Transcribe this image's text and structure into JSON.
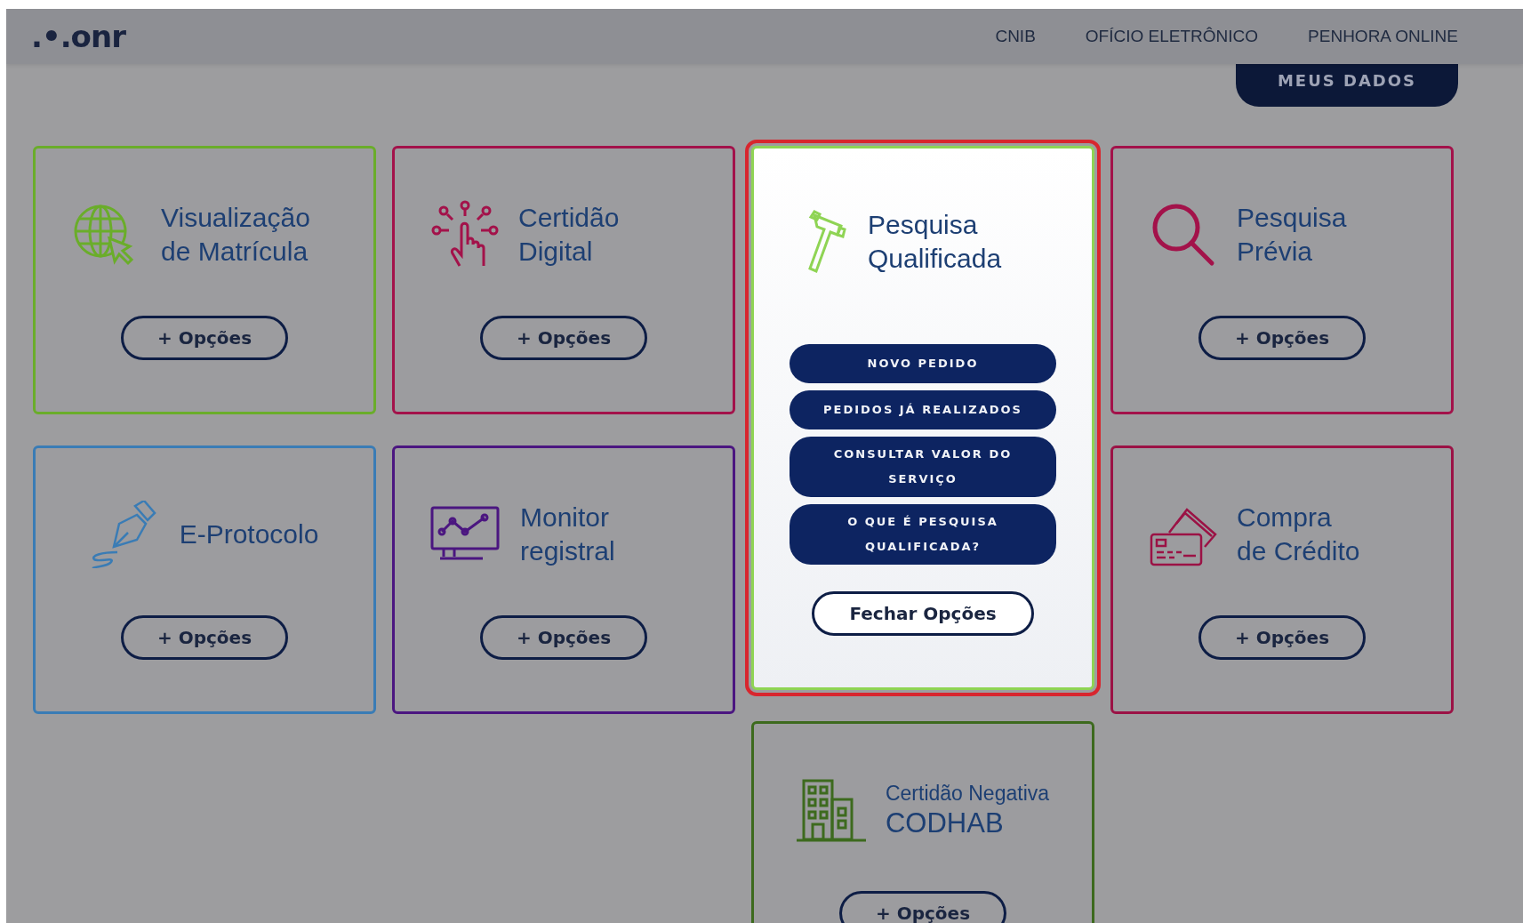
{
  "header": {
    "logo": ".•.onr",
    "nav": [
      "CNIB",
      "OFÍCIO ELETRÔNICO",
      "PENHORA ONLINE"
    ]
  },
  "account_button": "MEUS DADOS",
  "card_columns": [
    [
      {
        "title": "Visualização de Matrícula",
        "color": "#6aad2a",
        "expanded": false,
        "button": "+ Opções"
      },
      {
        "title": "E-Protocolo",
        "color": "#3a7cb5",
        "expanded": false,
        "button": "+ Opções"
      }
    ],
    [
      {
        "title": "Certidão Digital",
        "color": "#a3124a",
        "expanded": false,
        "button": "+ Opções"
      },
      {
        "title": "Monitor registral",
        "color": "#4b1680",
        "expanded": false,
        "button": "+ Opções"
      }
    ],
    [
      {
        "title": "Pesquisa Qualificada",
        "color": "#8fd454",
        "expanded": true,
        "options": [
          "NOVO PEDIDO",
          "PEDIDOS JÁ REALIZADOS",
          "CONSULTAR VALOR DO SERVIÇO",
          "O QUE É PESQUISA QUALIFICADA?"
        ],
        "button": "Fechar Opções"
      },
      {
        "title_lines": [
          "Certidão Negativa",
          "CODHAB"
        ],
        "color": "#3d6a1e",
        "expanded": false,
        "button": "+ Opções"
      }
    ],
    [
      {
        "title": "Pesquisa Prévia",
        "color": "#a3124a",
        "expanded": false,
        "button": "+ Opções"
      },
      {
        "title": "Compra de Crédito",
        "color": "#9b1245",
        "expanded": false,
        "button": "+ Opções"
      }
    ]
  ]
}
